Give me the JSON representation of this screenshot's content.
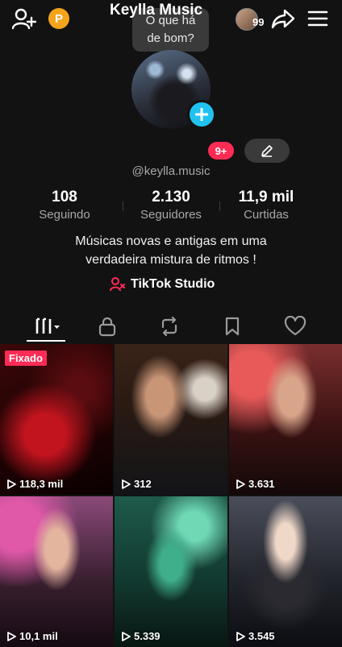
{
  "header": {
    "points_badge": "P",
    "bubble_line1": "O que há",
    "bubble_line2": "de bom?",
    "friends_count": "99"
  },
  "profile": {
    "name": "Keylla Music",
    "notif_badge": "9+",
    "handle": "@keylla.music",
    "stats": [
      {
        "value": "108",
        "label": "Seguindo"
      },
      {
        "value": "2.130",
        "label": "Seguidores"
      },
      {
        "value": "11,9 mil",
        "label": "Curtidas"
      }
    ],
    "bio_line1": "Músicas novas e antigas em uma",
    "bio_line2": "verdadeira mistura de ritmos !",
    "studio_link": "TikTok Studio"
  },
  "tabs": [
    "videos-icon",
    "lock-icon",
    "repost-icon",
    "bookmark-icon",
    "heart-icon"
  ],
  "videos": [
    {
      "pinned_label": "Fixado",
      "views": "118,3 mil"
    },
    {
      "views": "312"
    },
    {
      "views": "3.631"
    },
    {
      "views": "10,1 mil"
    },
    {
      "views": "5.339"
    },
    {
      "views": "3.545"
    }
  ],
  "colors": {
    "background": "#121212",
    "accent_red": "#fe2c55",
    "add_blue": "#20c3f0",
    "points_orange": "#f4a41c"
  }
}
